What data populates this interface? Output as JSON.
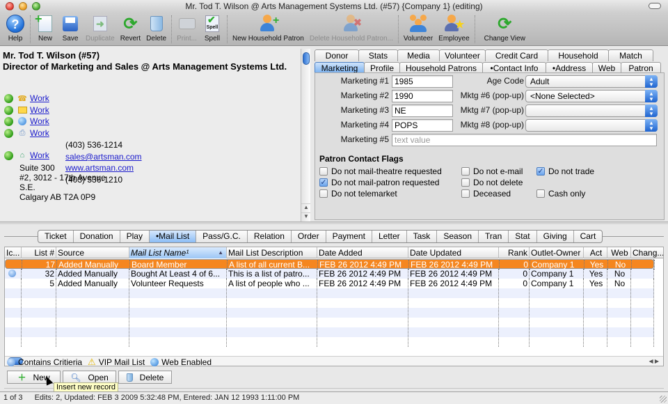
{
  "window": {
    "title": "Mr. Tod T. Wilson @ Arts Management Systems Ltd. (#57) {Company 1} (editing)"
  },
  "toolbar": {
    "items": [
      {
        "label": "Help",
        "icon": "help-icon",
        "enabled": true
      },
      {
        "label": "New",
        "icon": "new-document-icon",
        "enabled": true
      },
      {
        "label": "Save",
        "icon": "save-disk-icon",
        "enabled": true
      },
      {
        "label": "Duplicate",
        "icon": "duplicate-icon",
        "enabled": false
      },
      {
        "label": "Revert",
        "icon": "revert-icon",
        "enabled": true
      },
      {
        "label": "Delete",
        "icon": "trash-icon",
        "enabled": true
      },
      {
        "label": "Print...",
        "icon": "printer-icon",
        "enabled": false
      },
      {
        "label": "Spell",
        "icon": "spell-check-icon",
        "enabled": true
      },
      {
        "label": "New Household Patron",
        "icon": "add-person-icon",
        "enabled": true
      },
      {
        "label": "Delete Household Patron...",
        "icon": "remove-person-icon",
        "enabled": false
      },
      {
        "label": "Volunteer",
        "icon": "group-icon",
        "enabled": true
      },
      {
        "label": "Employee",
        "icon": "employee-star-icon",
        "enabled": true
      },
      {
        "label": "Change View",
        "icon": "change-view-icon",
        "enabled": true
      }
    ]
  },
  "patron": {
    "name": "Mr. Tod T. Wilson (#57)",
    "title_company": "Director of Marketing and Sales @ Arts Management Systems Ltd.",
    "contacts": [
      {
        "type": "phone",
        "label": "Work",
        "value": "(403) 536-1214",
        "is_link": false
      },
      {
        "type": "email",
        "label": "Work",
        "value": "sales@artsman.com",
        "is_link": true
      },
      {
        "type": "web",
        "label": "Work",
        "value": "www.artsman.com",
        "is_link": true
      },
      {
        "type": "fax",
        "label": "Work",
        "value": "(403) 536-1210",
        "is_link": false
      }
    ],
    "address": {
      "label": "Work",
      "lines": [
        "Suite 300",
        "#2, 3012 - 17th Avenue",
        "S.E.",
        "Calgary AB  T2A 0P9"
      ]
    }
  },
  "detail_tabs": {
    "row1": [
      "Donor",
      "Stats",
      "Media",
      "Volunteer",
      "Credit Card",
      "Household",
      "Match"
    ],
    "row2": [
      "Marketing",
      "Profile",
      "Household Patrons",
      "•Contact Info",
      "•Address",
      "Web",
      "Patron"
    ],
    "active": "Marketing"
  },
  "marketing": {
    "fields": [
      {
        "label": "Marketing #1",
        "value": "1985"
      },
      {
        "label": "Marketing #2",
        "value": "1990"
      },
      {
        "label": "Marketing #3",
        "value": "NE"
      },
      {
        "label": "Marketing #4",
        "value": "POPS"
      },
      {
        "label": "Marketing #5",
        "value": "",
        "placeholder": "text value"
      }
    ],
    "popups": [
      {
        "label": "Age Code",
        "value": "Adult"
      },
      {
        "label": "Mktg #6 (pop-up)",
        "value": "<None Selected>"
      },
      {
        "label": "Mktg #7 (pop-up)",
        "value": ""
      },
      {
        "label": "Mktg #8 (pop-up)",
        "value": ""
      }
    ],
    "flags_title": "Patron Contact Flags",
    "flags": [
      {
        "label": "Do not mail-theatre requested",
        "checked": false
      },
      {
        "label": "Do not e-mail",
        "checked": false
      },
      {
        "label": "Do not trade",
        "checked": true
      },
      {
        "label": "Do not mail-patron requested",
        "checked": true
      },
      {
        "label": "Do not delete",
        "checked": false
      },
      {
        "label": "Do not telemarket",
        "checked": false
      },
      {
        "label": "Deceased",
        "checked": false
      },
      {
        "label": "Cash only",
        "checked": false
      }
    ]
  },
  "bottom_tabs": {
    "items": [
      "Ticket",
      "Donation",
      "Play",
      "•Mail List",
      "Pass/G.C.",
      "Relation",
      "Order",
      "Payment",
      "Letter",
      "Task",
      "Season",
      "Tran",
      "Stat",
      "Giving",
      "Cart"
    ],
    "active": "•Mail List"
  },
  "mail_list_table": {
    "columns": [
      "Ic...",
      "List #",
      "Source",
      "Mail List Name¹",
      "Mail List Description",
      "Date Added",
      "Date Updated",
      "Rank",
      "Outlet-Owner",
      "Act",
      "Web",
      "Chang..."
    ],
    "sorted_column": "Mail List Name¹",
    "rows": [
      {
        "icon": "",
        "list_no": "17",
        "source": "Added Manually",
        "name": "Board Member",
        "description": "A list of all current B...",
        "date_added": "FEB 26 2012 4:49 PM",
        "date_updated": "FEB 26 2012 4:49 PM",
        "rank": "0",
        "owner": "Company 1",
        "act": "Yes",
        "web": "No",
        "changed": "",
        "selected": true
      },
      {
        "icon": "criteria-icon",
        "list_no": "32",
        "source": "Added Manually",
        "name": "Bought At Least 4 of 6...",
        "description": "This is a list of patro...",
        "date_added": "FEB 26 2012 4:49 PM",
        "date_updated": "FEB 26 2012 4:49 PM",
        "rank": "0",
        "owner": "Company 1",
        "act": "Yes",
        "web": "No",
        "changed": "",
        "selected": false
      },
      {
        "icon": "",
        "list_no": "5",
        "source": "Added Manually",
        "name": "Volunteer Requests",
        "description": "A list of people who ...",
        "date_added": "FEB 26 2012 4:49 PM",
        "date_updated": "FEB 26 2012 4:49 PM",
        "rank": "0",
        "owner": "Company 1",
        "act": "Yes",
        "web": "No",
        "changed": "",
        "selected": false
      }
    ]
  },
  "legend": {
    "items": [
      {
        "icon": "criteria-icon",
        "label": "Contains Critieria"
      },
      {
        "icon": "warning-icon",
        "label": "VIP Mail List"
      },
      {
        "icon": "globe-icon",
        "label": "Web Enabled"
      }
    ]
  },
  "list_buttons": {
    "new": "New",
    "open": "Open",
    "delete": "Delete"
  },
  "tooltip": "Insert new record",
  "status": {
    "record": "1 of 3",
    "info": "Edits: 2, Updated: FEB 3 2009 5:32:48 PM, Entered: JAN 12 1993 1:11:00 PM"
  },
  "colors": {
    "selection": "#f5861f",
    "link": "#1a1acc",
    "active_tab": "#74aef0",
    "row_stripe": "#ecf0fd"
  }
}
